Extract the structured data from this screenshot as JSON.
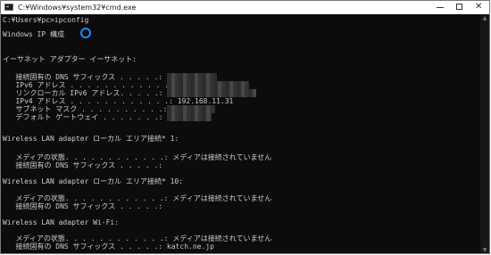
{
  "window": {
    "title": "C:¥Windows¥system32¥cmd.exe",
    "minimize_glyph": "",
    "close_glyph": "✕"
  },
  "console": {
    "lines": [
      "C:¥Users¥pc>ipconfig",
      "Windows IP 構成",
      "イーサネット アダプター イーサネット:",
      "   接続固有の DNS サフィックス . . . . .:",
      "   IPv6 アドレス . . . . . . . . . . . .:",
      "   リンクローカル IPv6 アドレス. . . . .:",
      "   IPv4 アドレス . . . . . . . . . . . .: 192.168.11.31",
      "   サブネット マスク . . . . . . . . . .:",
      "   デフォルト ゲートウェイ . . . . . . .:",
      "Wireless LAN adapter ローカル エリア接続* 1:",
      "   メディアの状態. . . . . . . . . . . .: メディアは接続されていません",
      "   接続固有の DNS サフィックス . . . . .:",
      "Wireless LAN adapter ローカル エリア接続* 10:",
      "   メディアの状態. . . . . . . . . . . .: メディアは接続されていません",
      "   接続固有の DNS サフィックス . . . . .:",
      "Wireless LAN adapter Wi-Fi:",
      "   メディアの状態. . . . . . . . . . . .: メディアは接続されていません",
      "   接続固有の DNS サフィックス . . . . .: katch.ne.jp"
    ]
  },
  "colors": {
    "console_bg": "#0c0c0c",
    "console_text": "#cccccc",
    "busy_indicator": "#1a8cff"
  },
  "icons": {
    "app": "cmd-icon",
    "busy": "busy-spinner-icon"
  }
}
